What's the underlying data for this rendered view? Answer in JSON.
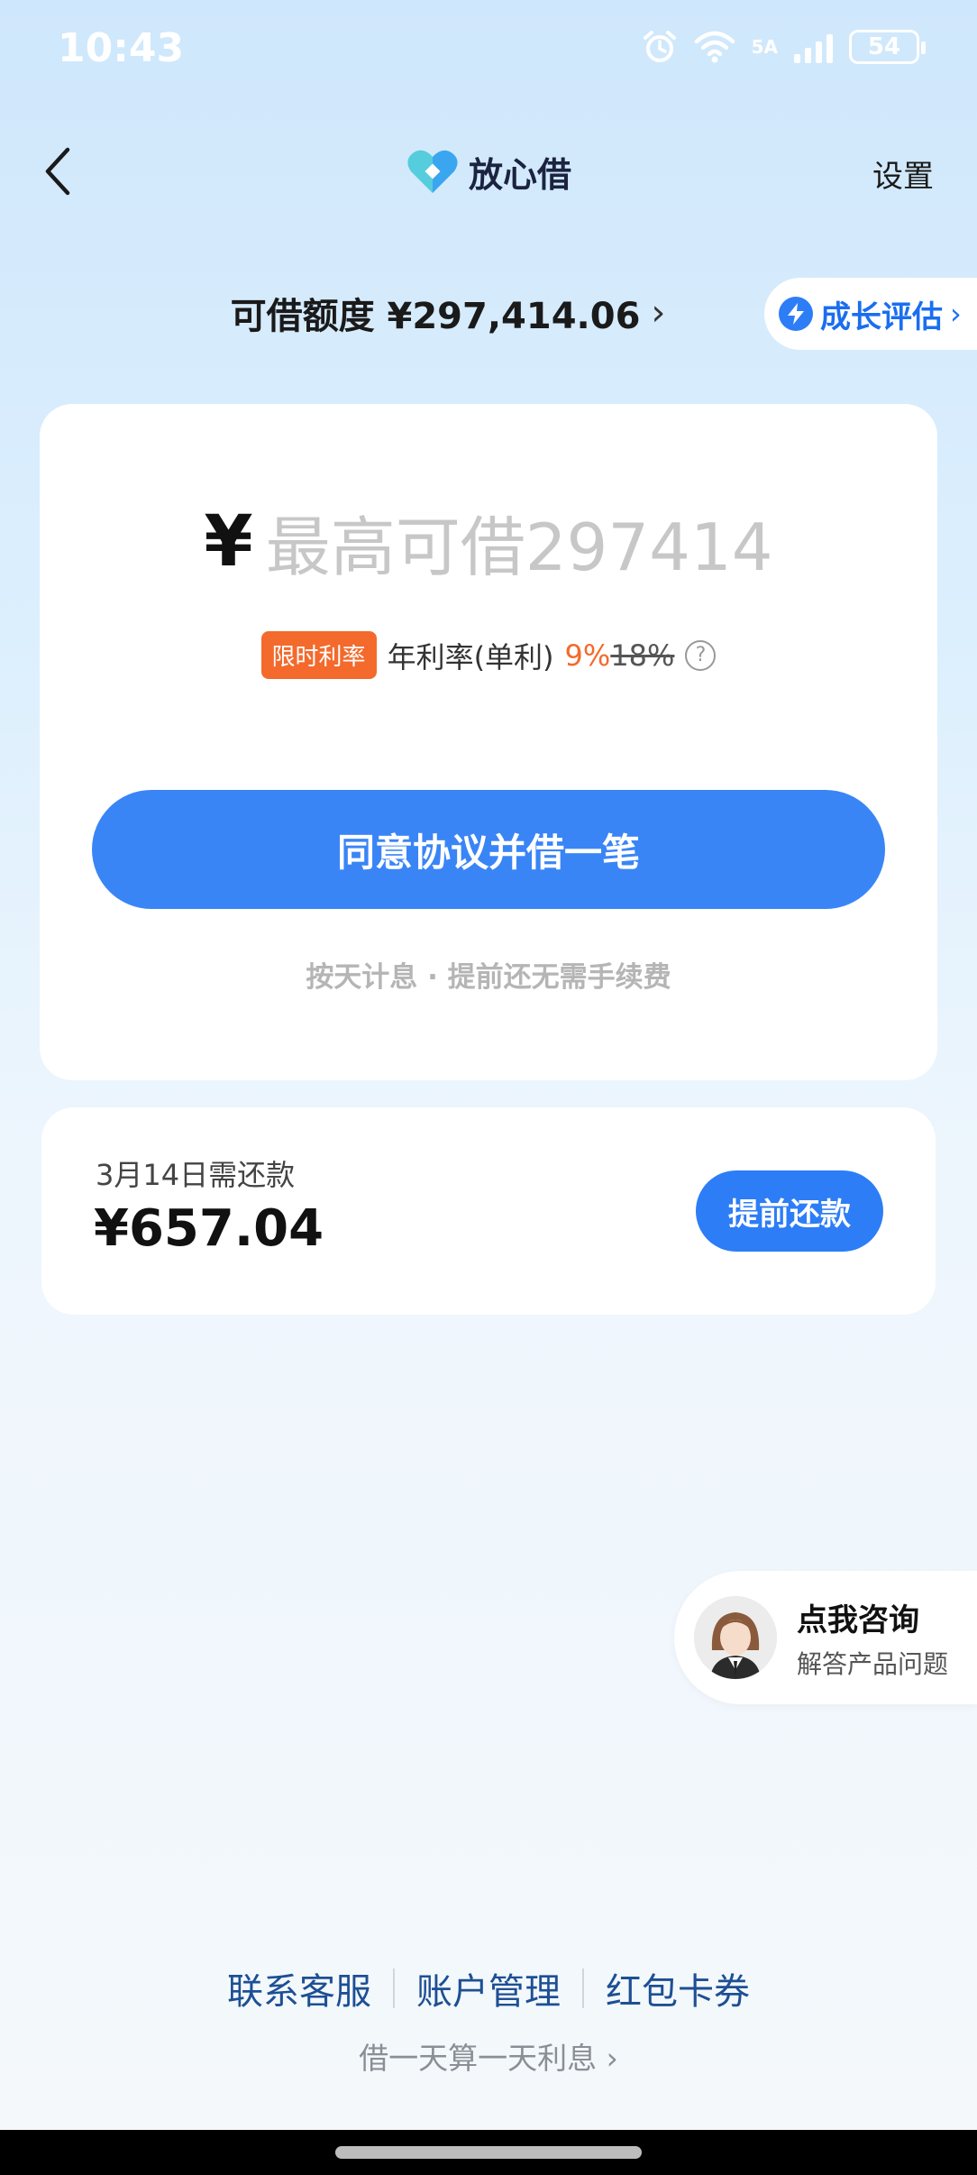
{
  "status_bar": {
    "time": "10:43",
    "network": "5A",
    "battery": "54",
    "icons": [
      "alarm-icon",
      "wifi-icon",
      "signal-icon",
      "battery-icon"
    ]
  },
  "header": {
    "brand_name": "放心借",
    "settings_label": "设置"
  },
  "quota": {
    "text": "可借额度 ¥297,414.06",
    "growth_label": "成长评估"
  },
  "borrow_card": {
    "currency": "¥",
    "placeholder": "最高可借297414",
    "rate_badge": "限时利率",
    "rate_label": "年利率(单利)",
    "rate_now": "9%",
    "rate_old": "18%",
    "button_label": "同意协议并借一笔",
    "note": "按天计息 · 提前还无需手续费"
  },
  "repay_card": {
    "due_label": "3月14日需还款",
    "amount": "¥657.04",
    "button_label": "提前还款"
  },
  "consult": {
    "title": "点我咨询",
    "subtitle": "解答产品问题"
  },
  "footer": {
    "links": [
      "联系客服",
      "账户管理",
      "红包卡券"
    ],
    "note": "借一天算一天利息"
  },
  "colors": {
    "primary_button": "#3a85f6",
    "accent_orange": "#f36a2c",
    "footer_link": "#1d4f94"
  }
}
